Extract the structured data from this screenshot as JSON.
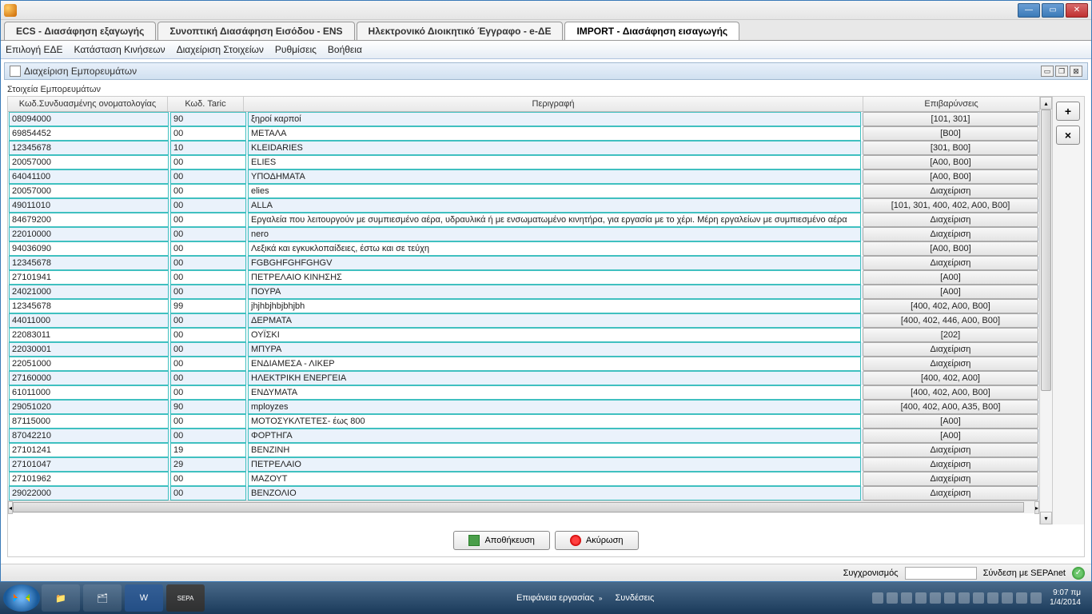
{
  "window": {
    "tabs": [
      "ECS - Διασάφηση εξαγωγής",
      "Συνοπτική Διασάφηση Εισόδου - ENS",
      "Ηλεκτρονικό Διοικητικό Έγγραφο - e-ΔΕ",
      "IMPORT - Διασάφηση εισαγωγής"
    ],
    "active_tab_index": 3
  },
  "menu": {
    "items": [
      "Επιλογή ΕΔΕ",
      "Κατάσταση Κινήσεων",
      "Διαχείριση Στοιχείων",
      "Ρυθμίσεις",
      "Βοήθεια"
    ]
  },
  "panel": {
    "title": "Διαχείριση Εμπορευμάτων",
    "subtitle": "Στοιχεία Εμπορευμάτων"
  },
  "table": {
    "headers": [
      "Κωδ.Συνδυασμένης ονοματολογίας",
      "Κωδ. Taric",
      "Περιγραφή",
      "Επιβαρύνσεις"
    ],
    "rows": [
      {
        "c1": "08094000",
        "c2": "90",
        "c3": "ξηροί καρποί",
        "c4": "[101, 301]"
      },
      {
        "c1": "69854452",
        "c2": "00",
        "c3": "ΜΕΤΑΛΑ",
        "c4": "[B00]"
      },
      {
        "c1": "12345678",
        "c2": "10",
        "c3": "KLEIDARIES",
        "c4": "[301, B00]"
      },
      {
        "c1": "20057000",
        "c2": "00",
        "c3": "ELIES",
        "c4": "[A00, B00]"
      },
      {
        "c1": "64041100",
        "c2": "00",
        "c3": "ΥΠΟΔΗΜΑΤΑ",
        "c4": "[A00, B00]"
      },
      {
        "c1": "20057000",
        "c2": "00",
        "c3": "elies",
        "c4": "Διαχείριση"
      },
      {
        "c1": "49011010",
        "c2": "00",
        "c3": "ALLA",
        "c4": "[101, 301, 400, 402, A00, B00]"
      },
      {
        "c1": "84679200",
        "c2": "00",
        "c3": "Εργαλεία που λειτουργούν με συμπιεσμένο αέρα, υδραυλικά ή με ενσωματωμένο κινητήρα, για εργασία με το χέρι. Μέρη εργαλείων με συμπιεσμένο αέρα",
        "c4": "Διαχείριση"
      },
      {
        "c1": "22010000",
        "c2": "00",
        "c3": "nero",
        "c4": "Διαχείριση"
      },
      {
        "c1": "94036090",
        "c2": "00",
        "c3": "Λεξικά και εγκυκλοπαίδειες, έστω και σε τεύχη",
        "c4": "[A00, B00]"
      },
      {
        "c1": "12345678",
        "c2": "00",
        "c3": "FGBGHFGHFGHGV",
        "c4": "Διαχείριση"
      },
      {
        "c1": "27101941",
        "c2": "00",
        "c3": "ΠΕΤΡΕΛΑΙΟ ΚΙΝΗΣΗΣ",
        "c4": "[A00]"
      },
      {
        "c1": "24021000",
        "c2": "00",
        "c3": "ΠΟΥΡΑ",
        "c4": "[A00]"
      },
      {
        "c1": "12345678",
        "c2": "99",
        "c3": "jhjhbjhbjbhjbh",
        "c4": "[400, 402, A00, B00]"
      },
      {
        "c1": "44011000",
        "c2": "00",
        "c3": "ΔΕΡΜΑΤΑ",
        "c4": "[400, 402, 446, A00, B00]"
      },
      {
        "c1": "22083011",
        "c2": "00",
        "c3": "ΟΥΪΣΚΙ",
        "c4": "[202]"
      },
      {
        "c1": "22030001",
        "c2": "00",
        "c3": "ΜΠΥΡΑ",
        "c4": "Διαχείριση"
      },
      {
        "c1": "22051000",
        "c2": "00",
        "c3": "ΕΝΔΙΑΜΕΣΑ - ΛΙΚΕΡ",
        "c4": "Διαχείριση"
      },
      {
        "c1": "27160000",
        "c2": "00",
        "c3": "ΗΛΕΚΤΡΙΚΗ ΕΝΕΡΓΕΙΑ",
        "c4": "[400, 402, A00]"
      },
      {
        "c1": "61011000",
        "c2": "00",
        "c3": "ΕΝΔΥΜΑΤΑ",
        "c4": "[400, 402, A00, B00]"
      },
      {
        "c1": "29051020",
        "c2": "90",
        "c3": "mployzes",
        "c4": "[400, 402, A00, A35, B00]"
      },
      {
        "c1": "87115000",
        "c2": "00",
        "c3": "ΜΟΤΟΣΥΚΛΤΕΤΕΣ- έως 800",
        "c4": "[A00]"
      },
      {
        "c1": "87042210",
        "c2": "00",
        "c3": "ΦΟΡΤΗΓΑ",
        "c4": "[A00]"
      },
      {
        "c1": "27101241",
        "c2": "19",
        "c3": "ΒΕΝΖΙΝΗ",
        "c4": "Διαχείριση"
      },
      {
        "c1": "27101047",
        "c2": "29",
        "c3": "ΠΕΤΡΕΛΑΙΟ",
        "c4": "Διαχείριση"
      },
      {
        "c1": "27101962",
        "c2": "00",
        "c3": "ΜΑΖΟΥΤ",
        "c4": "Διαχείριση"
      },
      {
        "c1": "29022000",
        "c2": "00",
        "c3": "ΒΕΝΖΟΛΙΟ",
        "c4": "Διαχείριση"
      }
    ]
  },
  "buttons": {
    "save": "Αποθήκευση",
    "cancel": "Ακύρωση",
    "add": "+",
    "remove": "×"
  },
  "status": {
    "sync_label": "Συγχρονισμός",
    "connect_label": "Σύνδεση με SEPAnet"
  },
  "taskbar": {
    "workspace": "Επιφάνεια εργασίας",
    "connections": "Συνδέσεις",
    "clock_time": "9:07 πμ",
    "clock_date": "1/4/2014"
  }
}
